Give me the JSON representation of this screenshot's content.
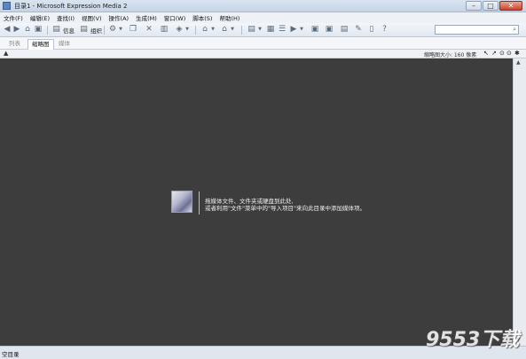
{
  "window": {
    "title": "目录1 - Microsoft Expression Media 2",
    "min": "–",
    "max": "□",
    "close": "✕"
  },
  "menu": [
    "文件(F)",
    "编辑(E)",
    "查找(I)",
    "视图(V)",
    "操作(A)",
    "生成(M)",
    "窗口(W)",
    "脚本(S)",
    "帮助(H)"
  ],
  "toolbar": {
    "info_label": "信息",
    "organize_label": "组织",
    "search_placeholder": ""
  },
  "tabs": [
    {
      "label": "列表",
      "active": false
    },
    {
      "label": "缩略图",
      "active": true
    },
    {
      "label": "媒体",
      "active": false
    }
  ],
  "infobar": {
    "sort": "▲",
    "thumb_size": "缩略图大小: 160 像素"
  },
  "hint": {
    "line1": "拖媒体文件、文件夹或硬盘到此处,",
    "line2": "或者利用\"文件\"菜单中的\"导入项目\"来向此目录中添加媒体项。"
  },
  "status": {
    "text": "空目录"
  },
  "watermark": "9553下载",
  "colors": {
    "content_bg": "#3d3d3d",
    "chrome": "#dfe6ee"
  }
}
